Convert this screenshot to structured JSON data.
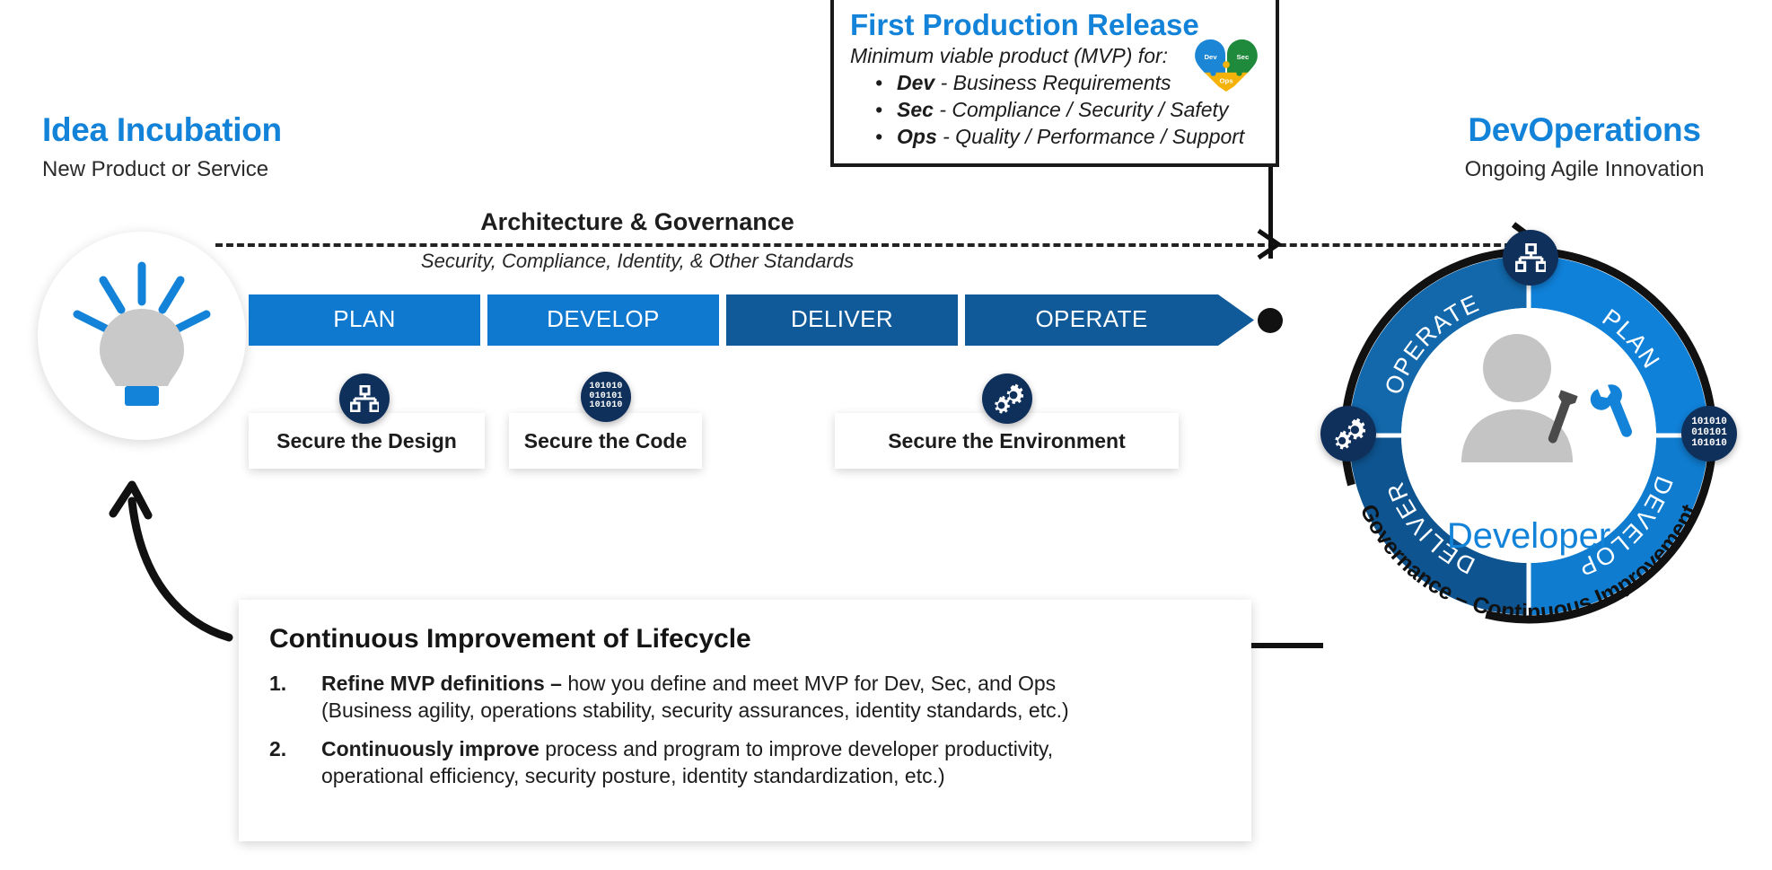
{
  "left_header": {
    "title": "Idea Incubation",
    "subtitle": "New Product or Service",
    "icon": "lightbulb-icon"
  },
  "right_header": {
    "title": "DevOperations",
    "subtitle": "Ongoing Agile Innovation"
  },
  "architecture": {
    "title": "Architecture & Governance",
    "subtitle": "Security, Compliance, Identity, & Other Standards"
  },
  "pipeline": {
    "stages": [
      {
        "label": "PLAN",
        "color": "#0f78cf"
      },
      {
        "label": "DEVELOP",
        "color": "#0f78cf"
      },
      {
        "label": "DELIVER",
        "color": "#105a9a"
      },
      {
        "label": "OPERATE",
        "color": "#105a9a"
      }
    ]
  },
  "secure_boxes": [
    {
      "label": "Secure the Design",
      "icon": "org-chart-icon"
    },
    {
      "label": "Secure the Code",
      "icon": "binary-code-icon"
    },
    {
      "label": "Secure the Environment",
      "icon": "gears-icon"
    }
  ],
  "mvp_callout": {
    "title": "First Production Release",
    "subtitle": "Minimum viable product (MVP) for:",
    "items": [
      {
        "term": "Dev",
        "text": " - Business Requirements"
      },
      {
        "term": "Sec",
        "text": " - Compliance / Security / Safety"
      },
      {
        "term": "Ops",
        "text": " - Quality / Performance / Support"
      }
    ],
    "heart": {
      "icon": "devsecops-heart-puzzle-icon",
      "pieces": [
        {
          "label": "Dev",
          "color": "#1b85d6"
        },
        {
          "label": "Sec",
          "color": "#1f8a3b"
        },
        {
          "label": "Ops",
          "color": "#f5b30a"
        }
      ]
    }
  },
  "continuous_improvement": {
    "title": "Continuous Improvement of Lifecycle",
    "items": [
      {
        "num": "1.",
        "bold": "Refine MVP definitions – ",
        "rest": "how you define and meet MVP for Dev, Sec, and Ops",
        "line2": "(Business agility, operations stability, security assurances, identity standards, etc.)"
      },
      {
        "num": "2.",
        "bold": "Continuously improve ",
        "rest": "process and program to improve developer productivity,",
        "line2": "operational efficiency, security posture, identity standardization, etc.)"
      }
    ]
  },
  "donut": {
    "center_label": "Developer",
    "center_icon": "developer-person-tools-icon",
    "outer_label": "Governance – Continuous Improvement",
    "segments": [
      {
        "label": "PLAN",
        "color": "#1081d9",
        "icon": "org-chart-icon"
      },
      {
        "label": "DEVELOP",
        "color": "#0f7ccf",
        "icon": "binary-code-icon"
      },
      {
        "label": "DELIVER",
        "color": "#0e5490",
        "icon": "none"
      },
      {
        "label": "OPERATE",
        "color": "#1268ab",
        "icon": "gears-icon"
      }
    ]
  },
  "colors": {
    "accent_blue": "#1283d8",
    "light_blue": "#0f78cf",
    "dark_blue": "#105a9a",
    "navy": "#10305c",
    "gray": "#c4c4c4",
    "black": "#1a1a1a"
  }
}
